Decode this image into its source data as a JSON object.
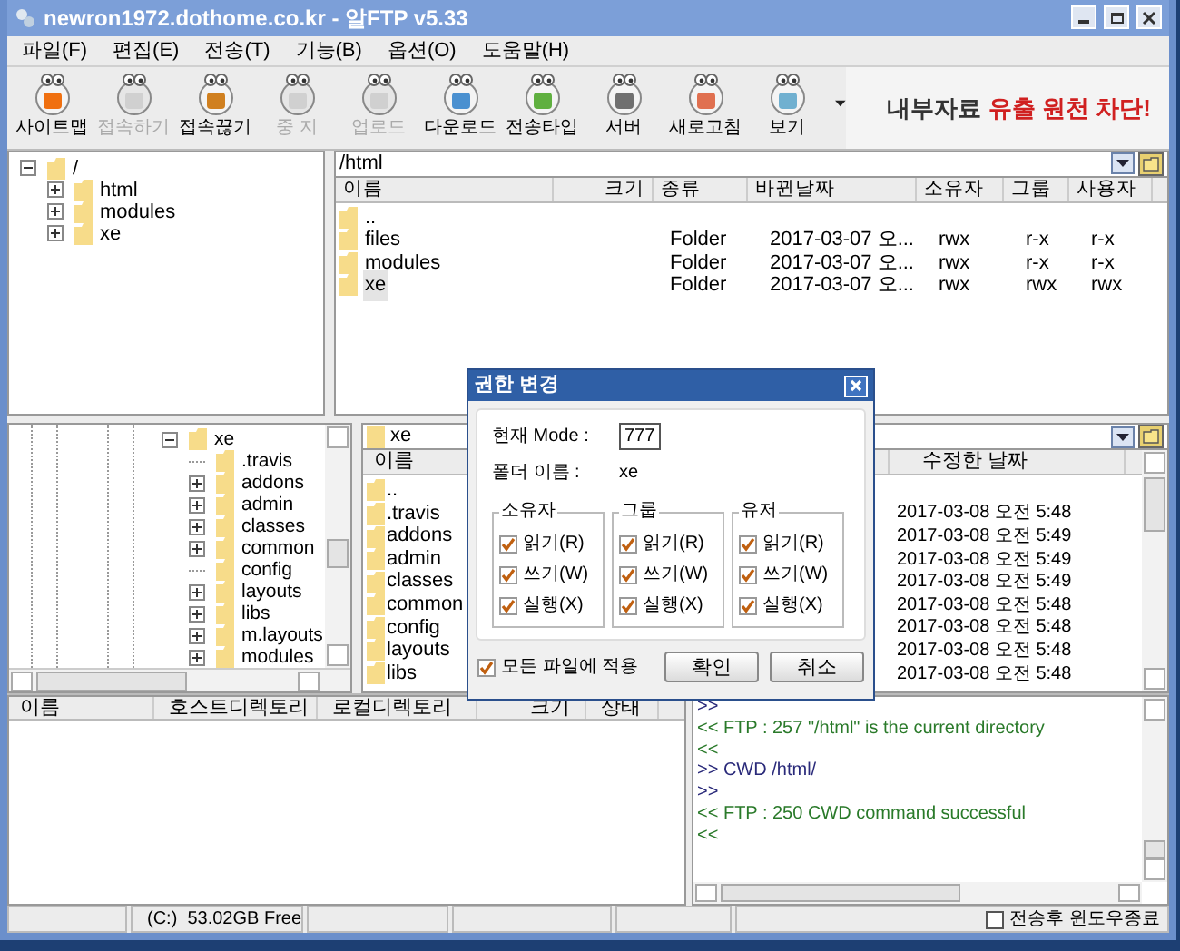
{
  "window": {
    "title": "newron1972.dothome.co.kr - 알FTP v5.33"
  },
  "menu": [
    "파일(F)",
    "편집(E)",
    "전송(T)",
    "기능(B)",
    "옵션(O)",
    "도움말(H)"
  ],
  "toolbar": [
    {
      "label": "사이트맵",
      "disabled": false
    },
    {
      "label": "접속하기",
      "disabled": true
    },
    {
      "label": "접속끊기",
      "disabled": false
    },
    {
      "label": "중 지",
      "disabled": true
    },
    {
      "label": "업로드",
      "disabled": true
    },
    {
      "label": "다운로드",
      "disabled": false
    },
    {
      "label": "전송타입",
      "disabled": false
    },
    {
      "label": "서버",
      "disabled": false
    },
    {
      "label": "새로고침",
      "disabled": false
    },
    {
      "label": "보기",
      "disabled": false
    }
  ],
  "banner": {
    "text": "내부자료",
    "highlight": "유출 원천 차단!"
  },
  "remote_tree": [
    {
      "label": "/",
      "has_children": true,
      "expanded": true,
      "children": [
        {
          "label": "html",
          "has_children": true,
          "expanded": false
        },
        {
          "label": "modules",
          "has_children": true,
          "expanded": false
        },
        {
          "label": "xe",
          "has_children": true,
          "expanded": false
        }
      ]
    }
  ],
  "remote_path": {
    "value": "/html"
  },
  "remote_list": {
    "columns": [
      "이름",
      "크기",
      "종류",
      "바뀐날짜",
      "소유자",
      "그룹",
      "사용자"
    ],
    "rows": [
      {
        "name": "..",
        "selected": false
      },
      {
        "name": "files",
        "type": "Folder",
        "modified": "2017-03-07 오...",
        "owner": "rwx",
        "group": "r-x",
        "user": "r-x",
        "selected": false
      },
      {
        "name": "modules",
        "type": "Folder",
        "modified": "2017-03-07 오...",
        "owner": "rwx",
        "group": "r-x",
        "user": "r-x",
        "selected": false
      },
      {
        "name": "xe",
        "type": "Folder",
        "modified": "2017-03-07 오...",
        "owner": "rwx",
        "group": "rwx",
        "user": "rwx",
        "selected": true
      }
    ]
  },
  "local_tree": [
    {
      "label": "xe",
      "has_children": true,
      "expanded": true,
      "children": [
        {
          "label": ".travis",
          "has_children": false
        },
        {
          "label": "addons",
          "has_children": true,
          "expanded": false
        },
        {
          "label": "admin",
          "has_children": true,
          "expanded": false
        },
        {
          "label": "classes",
          "has_children": true,
          "expanded": false
        },
        {
          "label": "common",
          "has_children": true,
          "expanded": false
        },
        {
          "label": "config",
          "has_children": false
        },
        {
          "label": "layouts",
          "has_children": true,
          "expanded": false
        },
        {
          "label": "libs",
          "has_children": true,
          "expanded": false
        },
        {
          "label": "m.layouts",
          "has_children": true,
          "expanded": false
        },
        {
          "label": "modules",
          "has_children": true,
          "expanded": false
        }
      ]
    }
  ],
  "local_path": {
    "value": "xe"
  },
  "local_list": {
    "columns": [
      "이름",
      "수정한 날짜"
    ],
    "rows": [
      {
        "name": ".."
      },
      {
        "name": ".travis",
        "modified": "2017-03-08 오전 5:48"
      },
      {
        "name": "addons",
        "modified": "2017-03-08 오전 5:49"
      },
      {
        "name": "admin",
        "modified": "2017-03-08 오전 5:49"
      },
      {
        "name": "classes",
        "modified": "2017-03-08 오전 5:49"
      },
      {
        "name": "common",
        "modified": "2017-03-08 오전 5:48"
      },
      {
        "name": "config",
        "modified": "2017-03-08 오전 5:48"
      },
      {
        "name": "layouts",
        "modified": "2017-03-08 오전 5:48"
      },
      {
        "name": "libs",
        "modified": "2017-03-08 오전 5:48"
      }
    ]
  },
  "transfer_list": {
    "columns": [
      "이름",
      "호스트디렉토리",
      "로컬디렉토리",
      "크기",
      "상태"
    ]
  },
  "log": [
    {
      "kind": "sent",
      "text": ">>"
    },
    {
      "kind": "received",
      "text": "<< FTP : 257 \"/html\" is the current directory"
    },
    {
      "kind": "received",
      "text": "<<"
    },
    {
      "kind": "sent",
      "text": ">> CWD /html/"
    },
    {
      "kind": "sent",
      "text": ">>"
    },
    {
      "kind": "received",
      "text": "<< FTP : 250 CWD command successful"
    },
    {
      "kind": "received",
      "text": "<<"
    }
  ],
  "status_bar": {
    "disk": "(C:)  53.02GB Free",
    "close_after_transfer": {
      "label": "전송후 윈도우종료",
      "checked": false
    }
  },
  "dialog": {
    "title": "권한 변경",
    "mode_label": "현재 Mode :",
    "mode": "777",
    "folder_label": "폴더 이름 :",
    "folder": "xe",
    "groups": [
      {
        "title": "소유자",
        "permissions": [
          {
            "label": "읽기(R)",
            "checked": true
          },
          {
            "label": "쓰기(W)",
            "checked": true
          },
          {
            "label": "실행(X)",
            "checked": true
          }
        ]
      },
      {
        "title": "그룹",
        "permissions": [
          {
            "label": "읽기(R)",
            "checked": true
          },
          {
            "label": "쓰기(W)",
            "checked": true
          },
          {
            "label": "실행(X)",
            "checked": true
          }
        ]
      },
      {
        "title": "유저",
        "permissions": [
          {
            "label": "읽기(R)",
            "checked": true
          },
          {
            "label": "쓰기(W)",
            "checked": true
          },
          {
            "label": "실행(X)",
            "checked": true
          }
        ]
      }
    ],
    "apply_all": {
      "label": "모든 파일에 적용",
      "checked": true
    },
    "buttons": [
      "확인",
      "취소"
    ]
  }
}
